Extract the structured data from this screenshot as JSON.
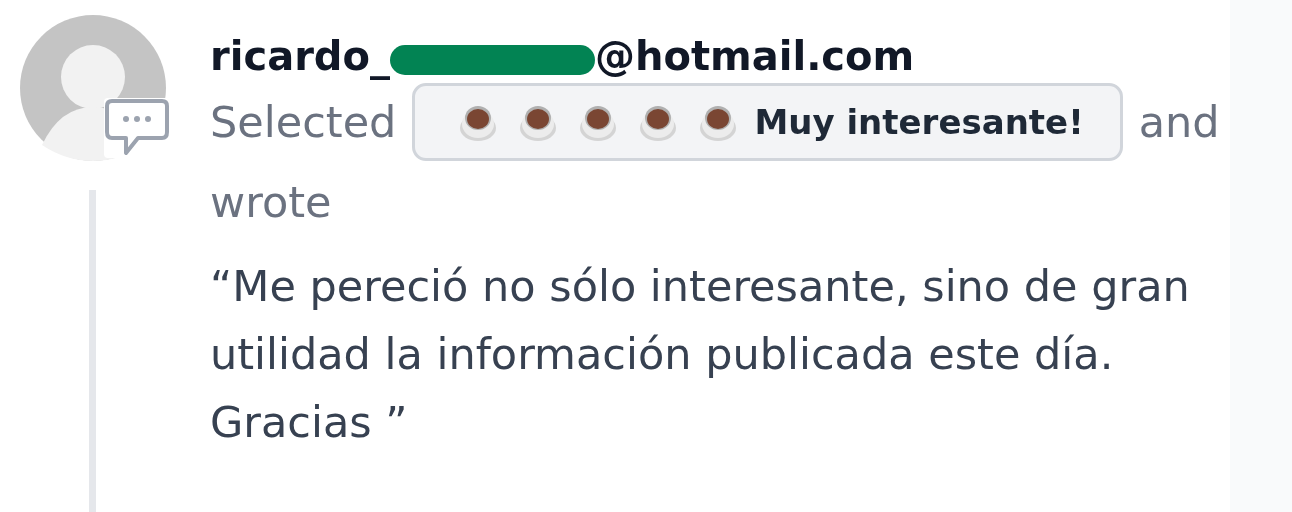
{
  "comment": {
    "author_start": "ricardo_",
    "author_end": "@hotmail.com",
    "prefix": "Selected",
    "rating": {
      "stars": 5,
      "label": "Muy interesante!"
    },
    "suffix_words": [
      "and",
      "wrote"
    ],
    "quote": "“Me pereció no sólo interesante, sino de gran utilidad la información publicada este día. Gracias ”"
  }
}
